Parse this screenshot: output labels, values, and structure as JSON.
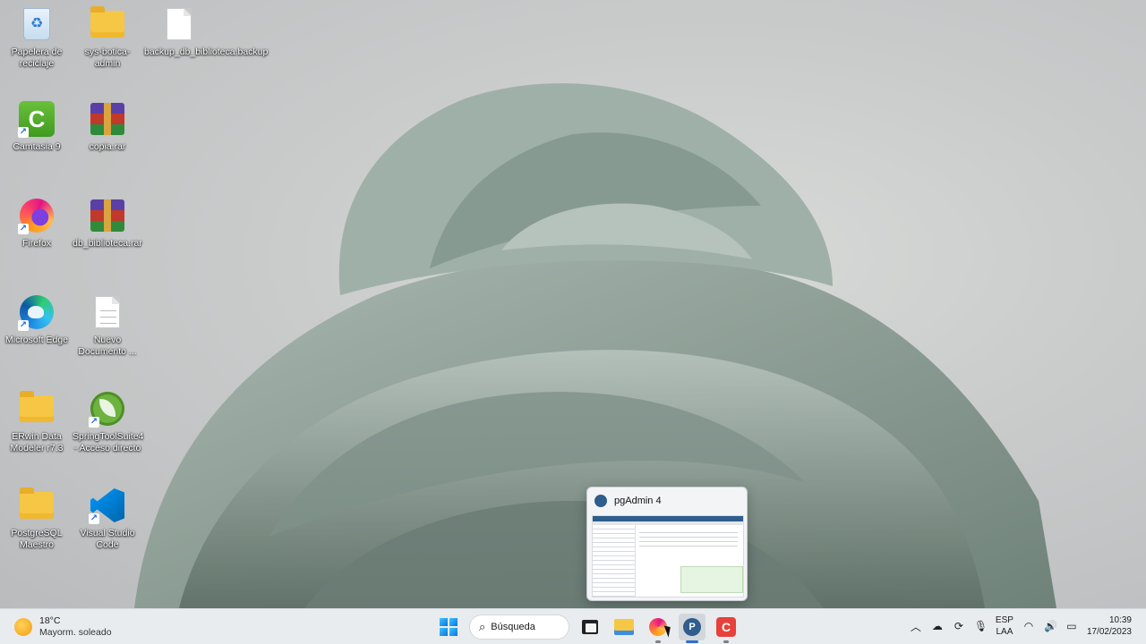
{
  "desktop": {
    "icons": [
      {
        "label": "Papelera de reciclaje"
      },
      {
        "label": "sys-botica-admin"
      },
      {
        "label": "backup_db_biblioteca.backup"
      },
      {
        "label": "Camtasia 9"
      },
      {
        "label": "copia.rar"
      },
      {
        "label": "Firefox"
      },
      {
        "label": "db_biblioteca.rar"
      },
      {
        "label": "Microsoft Edge"
      },
      {
        "label": "Nuevo Documento ..."
      },
      {
        "label": "ERwin Data Modeler r7.3"
      },
      {
        "label": "SpringToolSuite4 - Acceso directo"
      },
      {
        "label": "PostgreSQL Maestro"
      },
      {
        "label": "Visual Studio Code"
      }
    ]
  },
  "preview": {
    "title": "pgAdmin 4"
  },
  "taskbar": {
    "weather": {
      "temp": "18°C",
      "desc": "Mayorm. soleado"
    },
    "search_label": "Búsqueda",
    "tray": {
      "lang_line1": "ESP",
      "lang_line2": "LAA",
      "time": "10:39",
      "date": "17/02/2023"
    }
  }
}
